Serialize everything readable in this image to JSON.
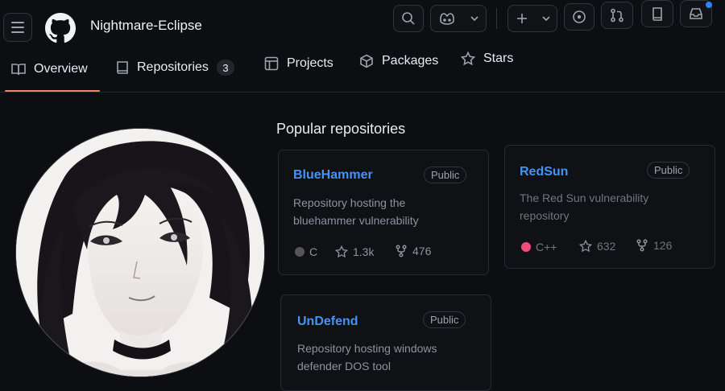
{
  "header": {
    "username": "Nightmare-Eclipse",
    "icons": [
      "menu-icon",
      "github-logo",
      "search-icon",
      "copilot-icon",
      "chevron-down-icon",
      "plus-icon",
      "issues-icon",
      "pull-requests-icon",
      "repo-icon",
      "inbox-icon"
    ]
  },
  "tabs": [
    {
      "label": "Overview",
      "icon": "book-icon",
      "selected": true
    },
    {
      "label": "Repositories",
      "icon": "repo-icon",
      "count": "3"
    },
    {
      "label": "Projects",
      "icon": "table-icon"
    },
    {
      "label": "Packages",
      "icon": "package-icon"
    },
    {
      "label": "Stars",
      "icon": "star-icon"
    }
  ],
  "popular": {
    "title": "Popular repositories",
    "repos": [
      {
        "name": "BlueHammer",
        "visibility": "Public",
        "description": "Repository hosting the bluehammer vulnerability",
        "language": "C",
        "language_color": "#555555",
        "stars": "1.3k",
        "forks": "476"
      },
      {
        "name": "RedSun",
        "visibility": "Public",
        "description": "The Red Sun vulnerability repository",
        "language": "C++",
        "language_color": "#f34b7d",
        "stars": "632",
        "forks": "126"
      },
      {
        "name": "UnDefend",
        "visibility": "Public",
        "description": "Repository hosting windows defender DOS tool"
      }
    ]
  },
  "colors": {
    "background": "#0d0e11",
    "link": "#4493f8",
    "tab_underline": "#f78166",
    "notification": "#2f81f7"
  }
}
